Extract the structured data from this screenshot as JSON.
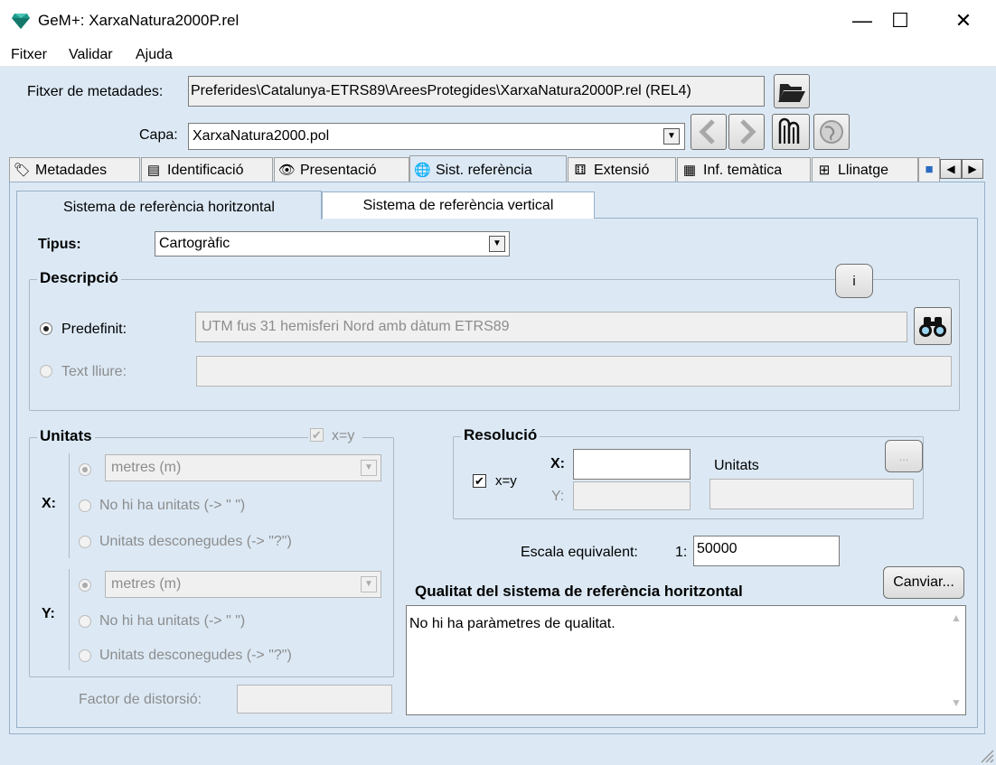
{
  "window": {
    "title": "GeM+: XarxaNatura2000P.rel",
    "minimize": "—",
    "maximize": "☐",
    "close": "✕"
  },
  "menu": [
    "Fitxer",
    "Validar",
    "Ajuda"
  ],
  "metadata_file": {
    "label": "Fitxer de metadades:",
    "value": "Preferides\\Catalunya-ETRS89\\AreesProtegides\\XarxaNatura2000P.rel (REL4)"
  },
  "layer": {
    "label": "Capa:",
    "value": "XarxaNatura2000.pol"
  },
  "icons": {
    "folder": "folder-open-icon",
    "prev": "chevron-left-icon",
    "next": "chevron-right-icon",
    "mm": "mm-logo-icon",
    "globe": "globe-icon",
    "binoculars": "binoculars-icon"
  },
  "tabs": [
    {
      "label": "Metadades",
      "icon": "🏷"
    },
    {
      "label": "Identificació",
      "icon": "▤"
    },
    {
      "label": "Presentació",
      "icon": "👁"
    },
    {
      "label": "Sist. referència",
      "icon": "🌐"
    },
    {
      "label": "Extensió",
      "icon": "⚅"
    },
    {
      "label": "Inf. temàtica",
      "icon": "▦"
    },
    {
      "label": "Llinatge",
      "icon": "⊞"
    }
  ],
  "subtabs": [
    "Sistema de referència horitzontal",
    "Sistema de referència vertical"
  ],
  "tipus": {
    "label": "Tipus:",
    "value": "Cartogràfic"
  },
  "descripcio": {
    "title": "Descripció",
    "info_button": "i",
    "predefinit_label": "Predefinit:",
    "predefinit_value": "UTM fus 31 hemisferi Nord amb dàtum ETRS89",
    "text_lliure_label": "Text lliure:",
    "text_lliure_value": ""
  },
  "unitats": {
    "title": "Unitats",
    "xy_label": "x=y",
    "x_label": "X:",
    "y_label": "Y:",
    "x_unit": "metres (m)",
    "y_unit": "metres (m)",
    "no_units": "No hi ha unitats (-> \" \")",
    "unknown_units": "Unitats desconegudes (-> \"?\")"
  },
  "distorsio": {
    "label": "Factor de distorsió:",
    "value": ""
  },
  "resolucio": {
    "title": "Resolució",
    "xy_label": "x=y",
    "x_label": "X:",
    "y_label": "Y:",
    "x_value": "",
    "y_value": "",
    "unitats_label": "Unitats",
    "unitats_value": "",
    "more_button": "..."
  },
  "escala": {
    "label": "Escala equivalent:",
    "prefix": "1:",
    "value": "50000"
  },
  "qualitat": {
    "title": "Qualitat del sistema de referència horitzontal",
    "change_button": "Canviar...",
    "text": "No hi ha paràmetres de qualitat."
  },
  "colors": {
    "background": "#dce9f5",
    "border": "#98b0c8"
  }
}
